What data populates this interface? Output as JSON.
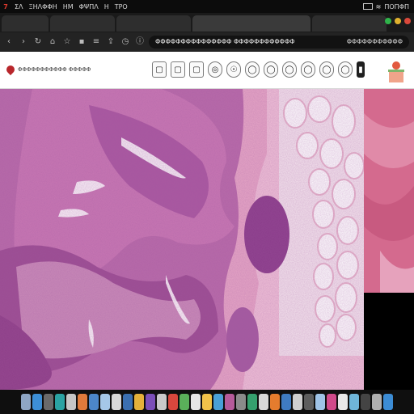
{
  "menubar": {
    "apple_label": "7",
    "menus": [
      "ΣΛ",
      "ΞΗΛΦΦΗ",
      "ΗΜ",
      "ΦΨΠΛ",
      "Η",
      "ΤΡΟ"
    ],
    "tray_text": "ΠΟΠΦΠ"
  },
  "tabs": [
    {
      "label": ""
    },
    {
      "label": ""
    },
    {
      "label": ""
    },
    {
      "label": ""
    },
    {
      "label": ""
    }
  ],
  "address_bar": {
    "left_text": "ΦΦΦΦΦΦΦΦΦΦΦΦΦΦΦ ΦΦΦΦΦΦΦΦΦΦΦΦ",
    "right_text": "ΦΦΦΦΦΦΦΦΦΦΦ"
  },
  "viewer": {
    "brand_text": "ΦΦΦΦΦΦΦΦΦΦΦ ΦΦΦΦΦ",
    "tool_glyphs": [
      "▢",
      "▢",
      "▢",
      "◎",
      "☉",
      "◯",
      "◯",
      "◯",
      "◯",
      "◯",
      "◯",
      "▮"
    ]
  },
  "colors": {
    "accent_red": "#b8262b",
    "tissue_pink": "#e8a0c4",
    "tissue_purple": "#9a4a8e",
    "fat_white": "#f4e8ee"
  }
}
